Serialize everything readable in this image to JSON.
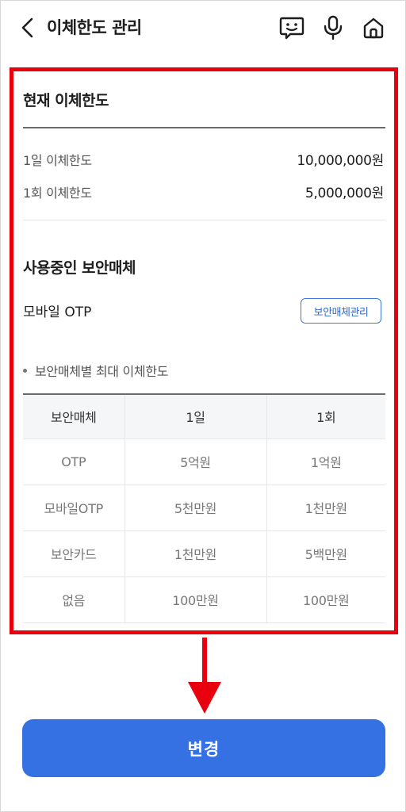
{
  "header": {
    "title": "이체한도 관리",
    "icons": [
      "back-chevron-icon",
      "chat-icon",
      "microphone-icon",
      "home-icon"
    ]
  },
  "current_limit": {
    "title": "현재 이체한도",
    "daily_label": "1일 이체한도",
    "daily_value": "10,000,000원",
    "per_transfer_label": "1회 이체한도",
    "per_transfer_value": "5,000,000원"
  },
  "security": {
    "title": "사용중인 보안매체",
    "device": "모바일 OTP",
    "manage_label": "보안매체관리",
    "note": "보안매체별 최대 이체한도"
  },
  "table": {
    "headers": [
      "보안매체",
      "1일",
      "1회"
    ],
    "rows": [
      [
        "OTP",
        "5억원",
        "1억원"
      ],
      [
        "모바일OTP",
        "5천만원",
        "1천만원"
      ],
      [
        "보안카드",
        "1천만원",
        "5백만원"
      ],
      [
        "없음",
        "100만원",
        "100만원"
      ]
    ]
  },
  "actions": {
    "change_label": "변경"
  },
  "colors": {
    "accent": "#3571e2",
    "highlight": "#e8000f",
    "outline_button": "#3f78d8"
  }
}
